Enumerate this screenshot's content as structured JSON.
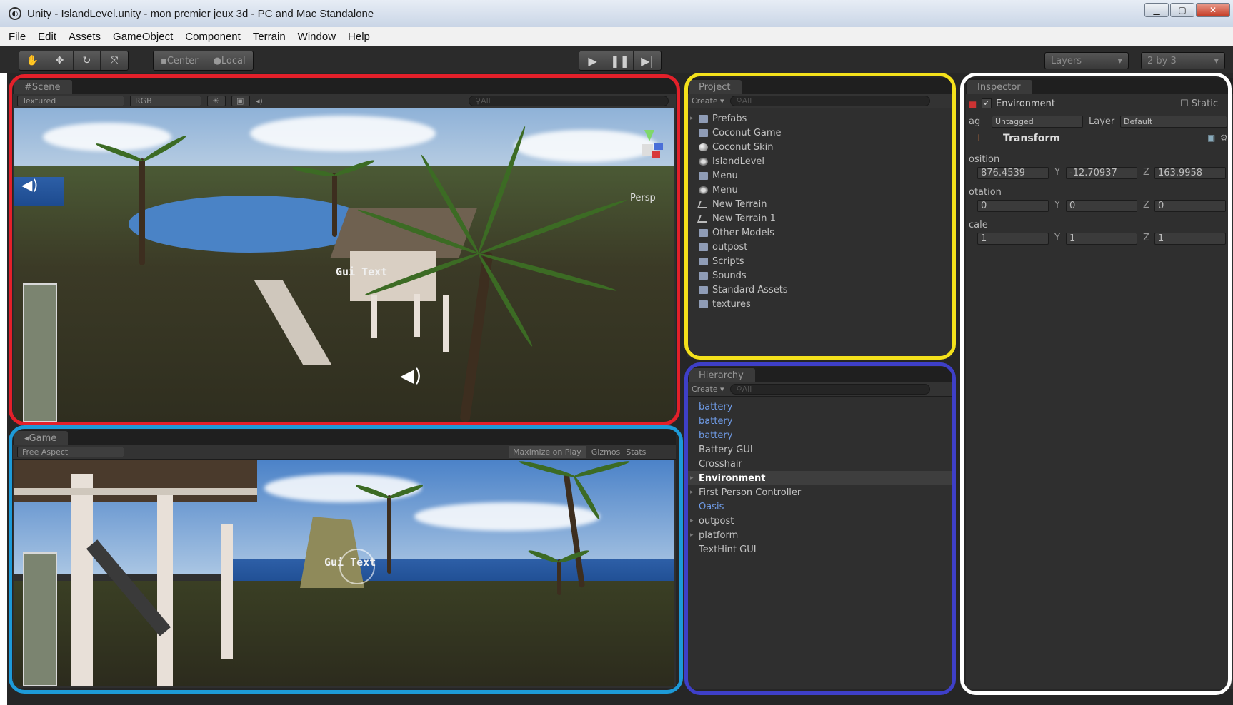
{
  "window": {
    "title": "Unity - IslandLevel.unity - mon premier jeux 3d - PC and Mac Standalone"
  },
  "menu": [
    "File",
    "Edit",
    "Assets",
    "GameObject",
    "Component",
    "Terrain",
    "Window",
    "Help"
  ],
  "toolbar": {
    "pivot_center": "Center",
    "pivot_local": "Local",
    "layers": "Layers",
    "layout": "2 by 3"
  },
  "scene": {
    "tab": "Scene",
    "render_mode": "Textured",
    "color_mode": "RGB",
    "search": "All",
    "persp": "Persp",
    "gui_text": "Gui Text"
  },
  "game": {
    "tab": "Game",
    "aspect": "Free Aspect",
    "maximize": "Maximize on Play",
    "gizmos": "Gizmos",
    "stats": "Stats",
    "gui_text": "Gui Text"
  },
  "project": {
    "tab": "Project",
    "create": "Create",
    "search": "All",
    "items": [
      {
        "label": "Prefabs"
      },
      {
        "label": "Coconut Game"
      },
      {
        "label": "Coconut Skin"
      },
      {
        "label": "IslandLevel"
      },
      {
        "label": "Menu"
      },
      {
        "label": "Menu"
      },
      {
        "label": "New Terrain"
      },
      {
        "label": "New Terrain 1"
      },
      {
        "label": "Other Models"
      },
      {
        "label": "outpost"
      },
      {
        "label": "Scripts"
      },
      {
        "label": "Sounds"
      },
      {
        "label": "Standard Assets"
      },
      {
        "label": "textures"
      }
    ]
  },
  "hierarchy": {
    "tab": "Hierarchy",
    "create": "Create",
    "search": "All",
    "items": [
      {
        "label": "battery"
      },
      {
        "label": "battery"
      },
      {
        "label": "battery"
      },
      {
        "label": "Battery GUI"
      },
      {
        "label": "Crosshair"
      },
      {
        "label": "Environment"
      },
      {
        "label": "First Person Controller"
      },
      {
        "label": "Oasis"
      },
      {
        "label": "outpost"
      },
      {
        "label": "platform"
      },
      {
        "label": "TextHint GUI"
      }
    ]
  },
  "inspector": {
    "tab": "Inspector",
    "object_name": "Environment",
    "static": "Static",
    "tag_label": "ag",
    "tag": "Untagged",
    "layer_label": "Layer",
    "layer": "Default",
    "component": "Transform",
    "position_label": "osition",
    "rotation_label": "otation",
    "scale_label": "cale",
    "position": {
      "x": "876.4539",
      "y": "-12.70937",
      "z": "163.9958"
    },
    "rotation": {
      "x": "0",
      "y": "0",
      "z": "0"
    },
    "scale": {
      "x": "1",
      "y": "1",
      "z": "1"
    },
    "axis_y": "Y",
    "axis_z": "Z"
  },
  "highlight_colors": {
    "scene": "#e3202a",
    "game": "#1d9ad8",
    "project": "#f4e11b",
    "hierarchy": "#3e3fc8",
    "inspector": "#ffffff"
  }
}
